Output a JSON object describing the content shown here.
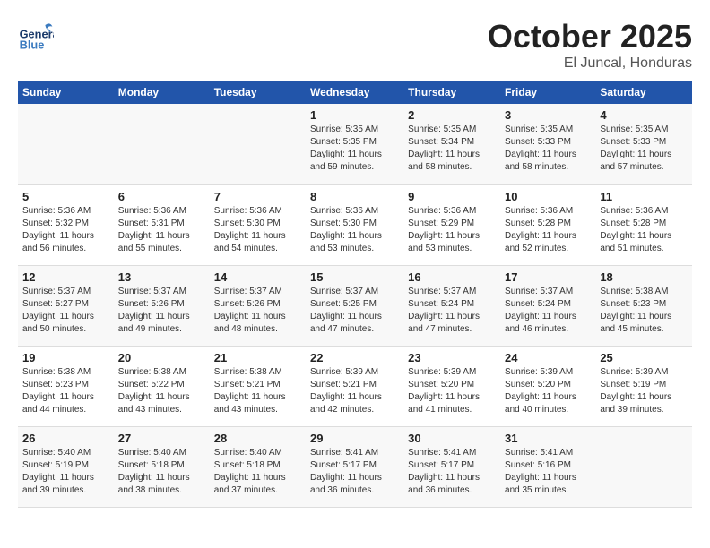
{
  "header": {
    "logo_general": "General",
    "logo_blue": "Blue",
    "title": "October 2025",
    "subtitle": "El Juncal, Honduras"
  },
  "weekdays": [
    "Sunday",
    "Monday",
    "Tuesday",
    "Wednesday",
    "Thursday",
    "Friday",
    "Saturday"
  ],
  "weeks": [
    [
      {
        "day": "",
        "info": ""
      },
      {
        "day": "",
        "info": ""
      },
      {
        "day": "",
        "info": ""
      },
      {
        "day": "1",
        "info": "Sunrise: 5:35 AM\nSunset: 5:35 PM\nDaylight: 11 hours\nand 59 minutes."
      },
      {
        "day": "2",
        "info": "Sunrise: 5:35 AM\nSunset: 5:34 PM\nDaylight: 11 hours\nand 58 minutes."
      },
      {
        "day": "3",
        "info": "Sunrise: 5:35 AM\nSunset: 5:33 PM\nDaylight: 11 hours\nand 58 minutes."
      },
      {
        "day": "4",
        "info": "Sunrise: 5:35 AM\nSunset: 5:33 PM\nDaylight: 11 hours\nand 57 minutes."
      }
    ],
    [
      {
        "day": "5",
        "info": "Sunrise: 5:36 AM\nSunset: 5:32 PM\nDaylight: 11 hours\nand 56 minutes."
      },
      {
        "day": "6",
        "info": "Sunrise: 5:36 AM\nSunset: 5:31 PM\nDaylight: 11 hours\nand 55 minutes."
      },
      {
        "day": "7",
        "info": "Sunrise: 5:36 AM\nSunset: 5:30 PM\nDaylight: 11 hours\nand 54 minutes."
      },
      {
        "day": "8",
        "info": "Sunrise: 5:36 AM\nSunset: 5:30 PM\nDaylight: 11 hours\nand 53 minutes."
      },
      {
        "day": "9",
        "info": "Sunrise: 5:36 AM\nSunset: 5:29 PM\nDaylight: 11 hours\nand 53 minutes."
      },
      {
        "day": "10",
        "info": "Sunrise: 5:36 AM\nSunset: 5:28 PM\nDaylight: 11 hours\nand 52 minutes."
      },
      {
        "day": "11",
        "info": "Sunrise: 5:36 AM\nSunset: 5:28 PM\nDaylight: 11 hours\nand 51 minutes."
      }
    ],
    [
      {
        "day": "12",
        "info": "Sunrise: 5:37 AM\nSunset: 5:27 PM\nDaylight: 11 hours\nand 50 minutes."
      },
      {
        "day": "13",
        "info": "Sunrise: 5:37 AM\nSunset: 5:26 PM\nDaylight: 11 hours\nand 49 minutes."
      },
      {
        "day": "14",
        "info": "Sunrise: 5:37 AM\nSunset: 5:26 PM\nDaylight: 11 hours\nand 48 minutes."
      },
      {
        "day": "15",
        "info": "Sunrise: 5:37 AM\nSunset: 5:25 PM\nDaylight: 11 hours\nand 47 minutes."
      },
      {
        "day": "16",
        "info": "Sunrise: 5:37 AM\nSunset: 5:24 PM\nDaylight: 11 hours\nand 47 minutes."
      },
      {
        "day": "17",
        "info": "Sunrise: 5:37 AM\nSunset: 5:24 PM\nDaylight: 11 hours\nand 46 minutes."
      },
      {
        "day": "18",
        "info": "Sunrise: 5:38 AM\nSunset: 5:23 PM\nDaylight: 11 hours\nand 45 minutes."
      }
    ],
    [
      {
        "day": "19",
        "info": "Sunrise: 5:38 AM\nSunset: 5:23 PM\nDaylight: 11 hours\nand 44 minutes."
      },
      {
        "day": "20",
        "info": "Sunrise: 5:38 AM\nSunset: 5:22 PM\nDaylight: 11 hours\nand 43 minutes."
      },
      {
        "day": "21",
        "info": "Sunrise: 5:38 AM\nSunset: 5:21 PM\nDaylight: 11 hours\nand 43 minutes."
      },
      {
        "day": "22",
        "info": "Sunrise: 5:39 AM\nSunset: 5:21 PM\nDaylight: 11 hours\nand 42 minutes."
      },
      {
        "day": "23",
        "info": "Sunrise: 5:39 AM\nSunset: 5:20 PM\nDaylight: 11 hours\nand 41 minutes."
      },
      {
        "day": "24",
        "info": "Sunrise: 5:39 AM\nSunset: 5:20 PM\nDaylight: 11 hours\nand 40 minutes."
      },
      {
        "day": "25",
        "info": "Sunrise: 5:39 AM\nSunset: 5:19 PM\nDaylight: 11 hours\nand 39 minutes."
      }
    ],
    [
      {
        "day": "26",
        "info": "Sunrise: 5:40 AM\nSunset: 5:19 PM\nDaylight: 11 hours\nand 39 minutes."
      },
      {
        "day": "27",
        "info": "Sunrise: 5:40 AM\nSunset: 5:18 PM\nDaylight: 11 hours\nand 38 minutes."
      },
      {
        "day": "28",
        "info": "Sunrise: 5:40 AM\nSunset: 5:18 PM\nDaylight: 11 hours\nand 37 minutes."
      },
      {
        "day": "29",
        "info": "Sunrise: 5:41 AM\nSunset: 5:17 PM\nDaylight: 11 hours\nand 36 minutes."
      },
      {
        "day": "30",
        "info": "Sunrise: 5:41 AM\nSunset: 5:17 PM\nDaylight: 11 hours\nand 36 minutes."
      },
      {
        "day": "31",
        "info": "Sunrise: 5:41 AM\nSunset: 5:16 PM\nDaylight: 11 hours\nand 35 minutes."
      },
      {
        "day": "",
        "info": ""
      }
    ]
  ]
}
